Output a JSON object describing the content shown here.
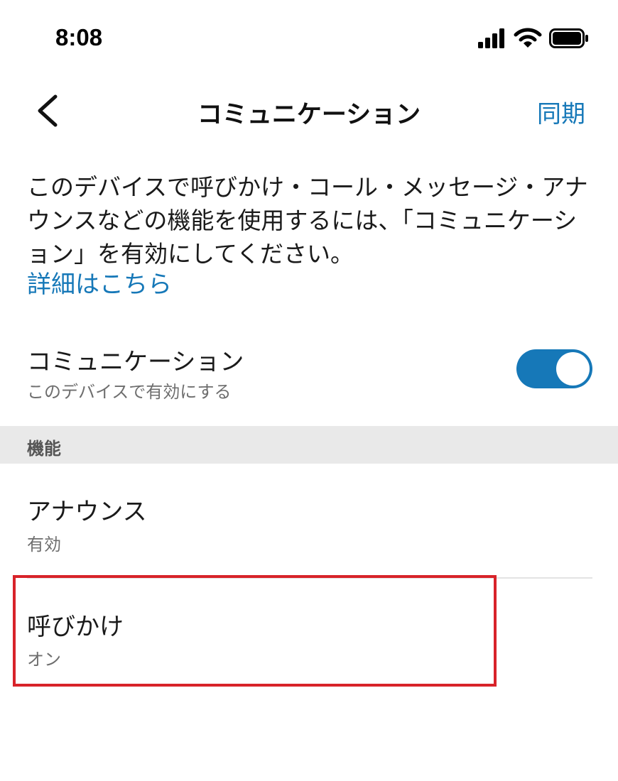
{
  "status_bar": {
    "time": "8:08",
    "icons": [
      "signal-icon",
      "wifi-icon",
      "battery-icon"
    ]
  },
  "nav": {
    "back_icon": "chevron-left-icon",
    "title": "コミュニケーション",
    "sync_label": "同期"
  },
  "description": {
    "text": "このデバイスで呼びかけ・コール・メッセージ・アナウンスなどの機能を使用するには、「コミュニケーション」を有効にしてください。",
    "link_label": "詳細はこちら"
  },
  "communication_toggle": {
    "title": "コミュニケーション",
    "subtitle": "このデバイスで有効にする",
    "enabled": true
  },
  "features_section": {
    "header": "機能",
    "items": [
      {
        "title": "アナウンス",
        "status": "有効"
      },
      {
        "title": "呼びかけ",
        "status": "オン"
      }
    ]
  },
  "colors": {
    "accent": "#1678b8",
    "section_bg": "#e9e9e9",
    "highlight": "#d8232a",
    "secondary_text": "#6e6e6e"
  }
}
